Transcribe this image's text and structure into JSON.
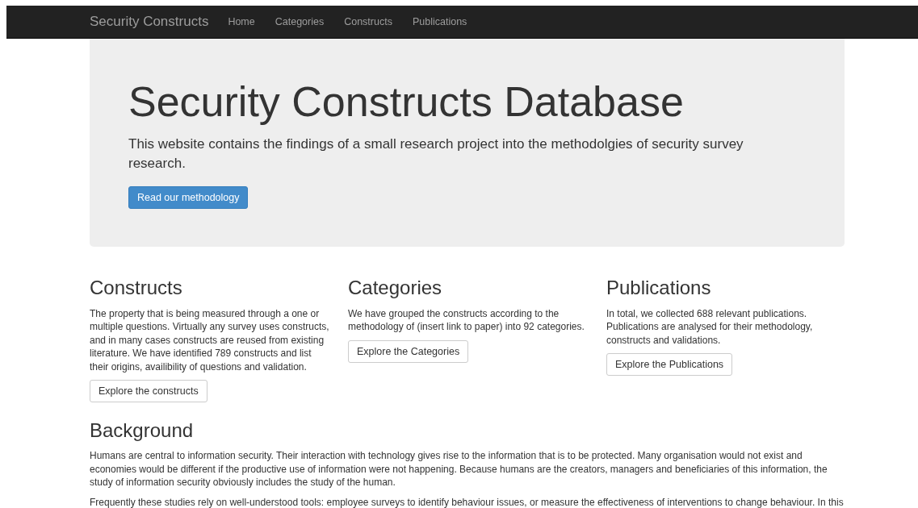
{
  "navbar": {
    "brand": "Security Constructs",
    "links": [
      {
        "label": "Home"
      },
      {
        "label": "Categories"
      },
      {
        "label": "Constructs"
      },
      {
        "label": "Publications"
      }
    ]
  },
  "hero": {
    "title": "Security Constructs Database",
    "lead": "This website contains the findings of a small research project into the methodolgies of security survey research.",
    "button": "Read our methodology"
  },
  "sections": [
    {
      "heading": "Constructs",
      "text": "The property that is being measured through a one or multiple questions. Virtually any survey uses constructs, and in many cases constructs are reused from existing literature. We have identified 789 constructs and list their origins, availibility of questions and validation.",
      "button": "Explore the constructs"
    },
    {
      "heading": "Categories",
      "text": "We have grouped the constructs according to the methodology of (insert link to paper) into 92 categories.",
      "button": "Explore the Categories"
    },
    {
      "heading": "Publications",
      "text": "In total, we collected 688 relevant publications. Publications are analysed for their methodology, constructs and validations.",
      "button": "Explore the Publications"
    }
  ],
  "background": {
    "heading": "Background",
    "paragraphs": [
      "Humans are central to information security. Their interaction with technology gives rise to the information that is to be protected. Many organisation would not exist and economies would be different if the productive use of information were not happening. Because humans are the creators, managers and beneficiaries of this information, the study of information security obviously includes the study of the human.",
      "Frequently these studies rely on well-understood tools: employee surveys to identify behaviour issues, or measure the effectiveness of interventions to change behaviour. In this"
    ]
  }
}
